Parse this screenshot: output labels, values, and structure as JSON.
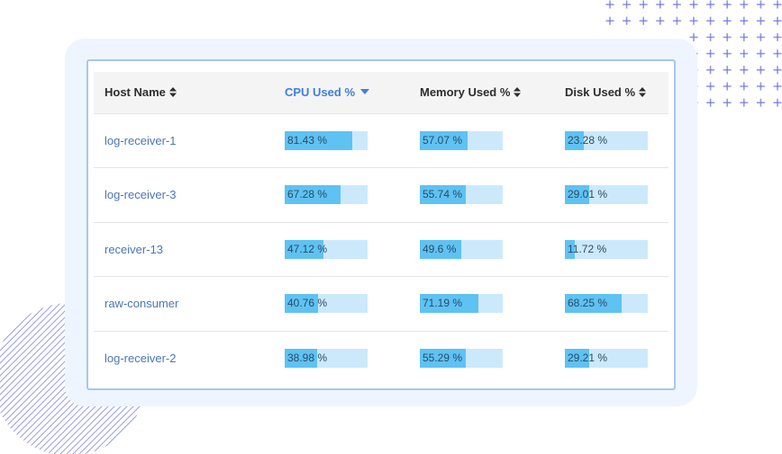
{
  "table": {
    "columns": [
      {
        "label": "Host Name",
        "sort_icon": "sort-both-icon",
        "active": false
      },
      {
        "label": "CPU Used %",
        "sort_icon": "sort-desc-icon",
        "active": true
      },
      {
        "label": "Memory Used %",
        "sort_icon": "sort-both-icon",
        "active": false
      },
      {
        "label": "Disk Used %",
        "sort_icon": "sort-both-icon",
        "active": false
      }
    ],
    "sort": {
      "column": "CPU Used %",
      "direction": "descending"
    },
    "percent_suffix": " %",
    "rows": [
      {
        "host": "log-receiver-1",
        "cpu": 81.43,
        "memory": 57.07,
        "disk": 23.28
      },
      {
        "host": "log-receiver-3",
        "cpu": 67.28,
        "memory": 55.74,
        "disk": 29.01
      },
      {
        "host": "receiver-13",
        "cpu": 47.12,
        "memory": 49.6,
        "disk": 11.72
      },
      {
        "host": "raw-consumer",
        "cpu": 40.76,
        "memory": 71.19,
        "disk": 68.25
      },
      {
        "host": "log-receiver-2",
        "cpu": 38.98,
        "memory": 55.29,
        "disk": 29.21
      }
    ]
  },
  "colors": {
    "active_header": "#3f7fdc",
    "host_link": "#4a77b4",
    "bar_fill": "#5ec2f3",
    "bar_track": "#cce9fb",
    "decoration": "#6f74e6"
  }
}
